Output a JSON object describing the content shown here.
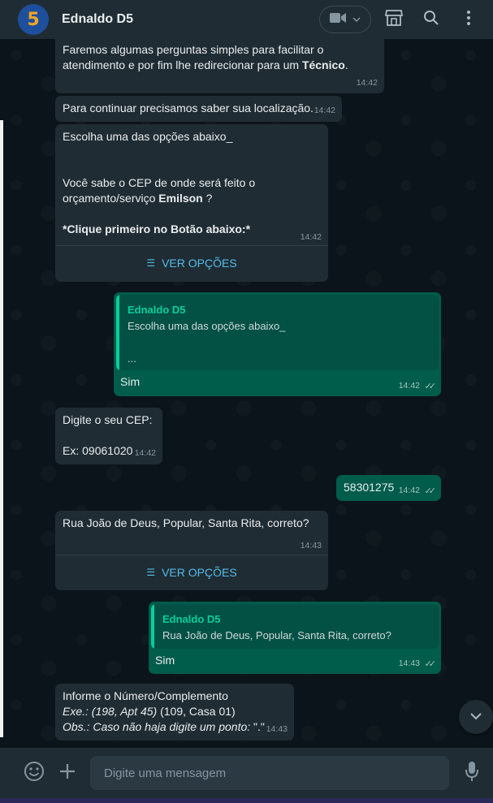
{
  "header": {
    "avatar_text": "5",
    "contact_name": "Ednaldo D5",
    "icons": [
      "video-call-icon",
      "chevron-down-icon",
      "shop-icon",
      "search-icon",
      "more-options-icon"
    ]
  },
  "messages": {
    "m1": {
      "line1": "Faremos algumas perguntas simples para facilitar o",
      "line2_pre": "atendimento e por fim lhe redirecionar para um ",
      "line2_bold": "Técnico",
      "line2_post": ".",
      "time": "14:42"
    },
    "m2": {
      "text": "Para continuar precisamos saber sua localização.",
      "time": "14:42"
    },
    "m3": {
      "line1": "Escolha uma das opções abaixo_",
      "line2": "Você sabe o CEP de onde será feito o",
      "line3_pre": "orçamento/serviço ",
      "line3_bold": "Emilson",
      "line3_post": " ?",
      "line4": "*Clique primeiro no Botão abaixo:*",
      "time": "14:42",
      "button": "VER OPÇÕES"
    },
    "m4": {
      "quote_name": "Ednaldo D5",
      "quote_line1": "Escolha uma das opções abaixo_",
      "quote_line2": "...",
      "text": "Sim",
      "time": "14:42"
    },
    "m5": {
      "line1": "Digite o seu CEP:",
      "line2": "Ex: 09061020",
      "time": "14:42"
    },
    "m6": {
      "text": "58301275",
      "time": "14:42"
    },
    "m7": {
      "text": "Rua João de Deus, Popular, Santa Rita, correto?",
      "time": "14:43",
      "button": "VER OPÇÕES"
    },
    "m8": {
      "quote_name": "Ednaldo D5",
      "quote_line1": "Rua João de Deus, Popular, Santa Rita, correto?",
      "text": "Sim",
      "time": "14:43"
    },
    "m9": {
      "line1": "Informe o Número/Complemento",
      "line2_italic": "Exe.: (198, Apt 45)",
      "line2_rest": " (109, Casa 01)",
      "line3_italic": "Obs.: Caso não haja digite um ponto: ",
      "line3_rest": "\".\"",
      "time": "14:43"
    }
  },
  "footer": {
    "placeholder": "Digite uma mensagem"
  },
  "colors": {
    "incoming": "#202c33",
    "outgoing": "#005c4b",
    "accent": "#06cf9c",
    "link": "#53bdeb"
  }
}
